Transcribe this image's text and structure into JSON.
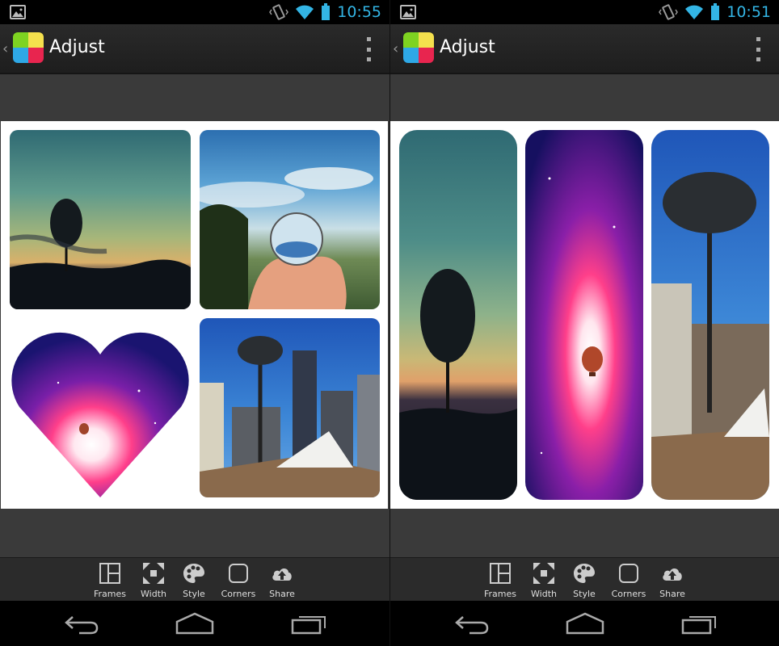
{
  "screens": [
    {
      "status": {
        "time": "10:55"
      },
      "actionbar": {
        "title": "Adjust"
      },
      "toolbar": {
        "items": [
          {
            "label": "Frames",
            "icon": "frames-icon"
          },
          {
            "label": "Width",
            "icon": "width-icon"
          },
          {
            "label": "Style",
            "icon": "palette-icon"
          },
          {
            "label": "Corners",
            "icon": "corners-icon"
          },
          {
            "label": "Share",
            "icon": "cloud-upload-icon"
          }
        ]
      }
    },
    {
      "status": {
        "time": "10:51"
      },
      "actionbar": {
        "title": "Adjust"
      },
      "toolbar": {
        "items": [
          {
            "label": "Frames",
            "icon": "frames-icon"
          },
          {
            "label": "Width",
            "icon": "width-icon"
          },
          {
            "label": "Style",
            "icon": "palette-icon"
          },
          {
            "label": "Corners",
            "icon": "corners-icon"
          },
          {
            "label": "Share",
            "icon": "cloud-upload-icon"
          }
        ]
      }
    }
  ],
  "colors": {
    "status_accent": "#33b5e5",
    "logo": [
      "#7ed321",
      "#2ea8e6",
      "#e8254f",
      "#f4e04d"
    ]
  }
}
